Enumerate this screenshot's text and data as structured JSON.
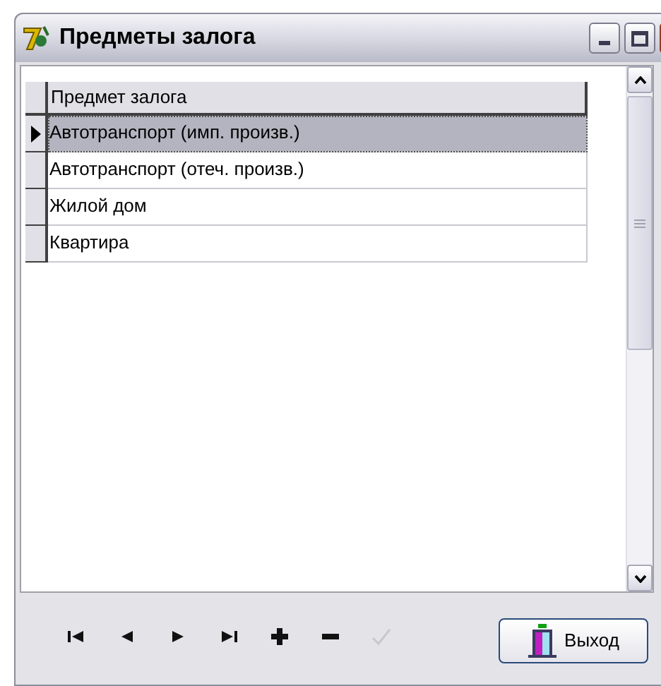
{
  "window": {
    "title": "Предметы залога"
  },
  "table": {
    "columns": [
      "Предмет залога"
    ],
    "rows": [
      {
        "cells": [
          "Автотранспорт (имп. произв.)"
        ],
        "selected": true
      },
      {
        "cells": [
          "Автотранспорт (отеч. произв.)"
        ],
        "selected": false
      },
      {
        "cells": [
          "Жилой дом"
        ],
        "selected": false
      },
      {
        "cells": [
          "Квартира"
        ],
        "selected": false
      }
    ]
  },
  "navigator": [
    {
      "kind": "first",
      "disabled": false
    },
    {
      "kind": "prior",
      "disabled": false
    },
    {
      "kind": "next",
      "disabled": false
    },
    {
      "kind": "last",
      "disabled": false
    },
    {
      "kind": "insert",
      "disabled": false
    },
    {
      "kind": "delete",
      "disabled": false
    },
    {
      "kind": "post",
      "disabled": true
    }
  ],
  "buttons": [
    {
      "label": "Выход"
    }
  ]
}
